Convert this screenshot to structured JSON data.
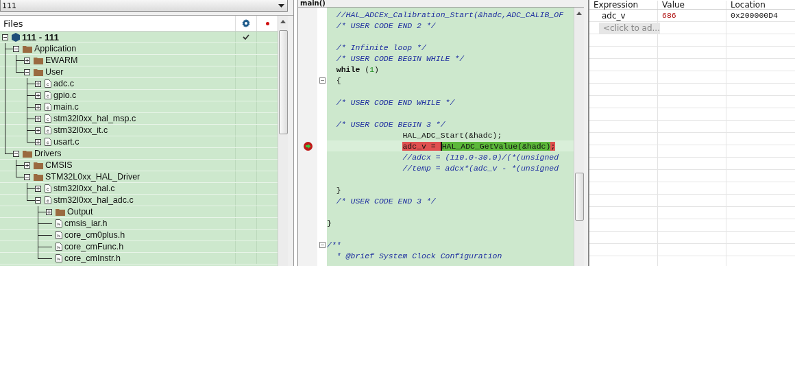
{
  "project_selector": {
    "value": "111"
  },
  "files_panel": {
    "title": "Files",
    "tree": [
      {
        "label": "111 - 111",
        "kind": "project",
        "expanded": true,
        "checked": true,
        "children": [
          {
            "label": "Application",
            "kind": "folder",
            "expanded": true,
            "checked": false,
            "children": [
              {
                "label": "EWARM",
                "kind": "folder",
                "expanded": false,
                "checked": false
              },
              {
                "label": "User",
                "kind": "folder",
                "expanded": true,
                "checked": false,
                "children": [
                  {
                    "label": "adc.c",
                    "kind": "c-file",
                    "expanded": false,
                    "checked": false
                  },
                  {
                    "label": "gpio.c",
                    "kind": "c-file",
                    "expanded": false,
                    "checked": false
                  },
                  {
                    "label": "main.c",
                    "kind": "c-file",
                    "expanded": false,
                    "checked": false
                  },
                  {
                    "label": "stm32l0xx_hal_msp.c",
                    "kind": "c-file",
                    "expanded": false,
                    "checked": false
                  },
                  {
                    "label": "stm32l0xx_it.c",
                    "kind": "c-file",
                    "expanded": false,
                    "checked": false
                  },
                  {
                    "label": "usart.c",
                    "kind": "c-file",
                    "expanded": false,
                    "checked": false
                  }
                ]
              }
            ]
          },
          {
            "label": "Drivers",
            "kind": "folder",
            "expanded": true,
            "checked": false,
            "children": [
              {
                "label": "CMSIS",
                "kind": "folder",
                "expanded": false,
                "checked": false
              },
              {
                "label": "STM32L0xx_HAL_Driver",
                "kind": "folder",
                "expanded": true,
                "checked": false,
                "children": [
                  {
                    "label": "stm32l0xx_hal.c",
                    "kind": "c-file",
                    "expanded": false,
                    "checked": false
                  },
                  {
                    "label": "stm32l0xx_hal_adc.c",
                    "kind": "c-file",
                    "expanded": true,
                    "checked": false,
                    "children": [
                      {
                        "label": "Output",
                        "kind": "folder",
                        "expanded": false,
                        "checked": false
                      },
                      {
                        "label": "cmsis_iar.h",
                        "kind": "h-file",
                        "checked": false
                      },
                      {
                        "label": "core_cm0plus.h",
                        "kind": "h-file",
                        "checked": false
                      },
                      {
                        "label": "core_cmFunc.h",
                        "kind": "h-file",
                        "checked": false
                      },
                      {
                        "label": "core_cmInstr.h",
                        "kind": "h-file",
                        "checked": false
                      }
                    ]
                  }
                ]
              }
            ]
          }
        ]
      }
    ]
  },
  "editor": {
    "tab": "main()",
    "lines": [
      {
        "fold": false,
        "current": false,
        "segments": [
          {
            "kind": "comment",
            "text": "  //HAL_ADCEx_Calibration_Start(&hadc,ADC_CALIB_OF"
          }
        ]
      },
      {
        "fold": false,
        "current": false,
        "segments": [
          {
            "kind": "comment",
            "text": "  /* USER CODE END 2 */"
          }
        ]
      },
      {
        "fold": false,
        "current": false
      },
      {
        "fold": false,
        "current": false,
        "segments": [
          {
            "kind": "comment",
            "text": "  /* Infinite loop */"
          }
        ]
      },
      {
        "fold": false,
        "current": false,
        "segments": [
          {
            "kind": "comment",
            "text": "  /* USER CODE BEGIN WHILE */"
          }
        ]
      },
      {
        "fold": false,
        "current": false,
        "segments": [
          {
            "kind": "keyword",
            "text": "  while"
          },
          {
            "kind": "code",
            "text": " ("
          },
          {
            "kind": "number",
            "text": "1"
          },
          {
            "kind": "code",
            "text": ")"
          }
        ]
      },
      {
        "fold": true,
        "current": false,
        "segments": [
          {
            "kind": "code",
            "text": "  {"
          }
        ]
      },
      {
        "fold": false,
        "current": false
      },
      {
        "fold": false,
        "current": false,
        "segments": [
          {
            "kind": "comment",
            "text": "  /* USER CODE END WHILE */"
          }
        ]
      },
      {
        "fold": false,
        "current": false
      },
      {
        "fold": false,
        "current": false,
        "segments": [
          {
            "kind": "comment",
            "text": "  /* USER CODE BEGIN 3 */"
          }
        ]
      },
      {
        "fold": false,
        "current": false,
        "segments": [
          {
            "kind": "code",
            "text": "                HAL_ADC_Start(&hadc);"
          }
        ]
      },
      {
        "fold": false,
        "current": true,
        "segments": [
          {
            "kind": "error",
            "text": "                adc_v = "
          },
          {
            "kind": "active",
            "text": "HAL_ADC_GetValue(&hadc)"
          },
          {
            "kind": "error",
            "text": ";"
          }
        ]
      },
      {
        "fold": false,
        "current": false,
        "segments": [
          {
            "kind": "comment",
            "text": "                //adcx = (110.0-30.0)/(*(unsigned"
          }
        ]
      },
      {
        "fold": false,
        "current": false,
        "segments": [
          {
            "kind": "comment",
            "text": "                //temp = adcx*(adc_v - *(unsigned"
          }
        ]
      },
      {
        "fold": false,
        "current": false
      },
      {
        "fold": false,
        "current": false,
        "segments": [
          {
            "kind": "code",
            "text": "  }"
          }
        ]
      },
      {
        "fold": false,
        "current": false,
        "segments": [
          {
            "kind": "comment",
            "text": "  /* USER CODE END 3 */"
          }
        ]
      },
      {
        "fold": false,
        "current": false
      },
      {
        "fold": false,
        "current": false,
        "segments": [
          {
            "kind": "code",
            "text": "}"
          }
        ]
      },
      {
        "fold": false,
        "current": false
      },
      {
        "fold": true,
        "current": false,
        "segments": [
          {
            "kind": "comment",
            "text": "/**"
          }
        ]
      },
      {
        "fold": false,
        "current": false,
        "segments": [
          {
            "kind": "comment",
            "text": "  * @brief System Clock Configuration"
          }
        ]
      }
    ]
  },
  "watch": {
    "columns": [
      "Expression",
      "Value",
      "Location"
    ],
    "rows": [
      {
        "expression": "adc_v",
        "value": "686",
        "location": "0x200000D4",
        "changed": true
      }
    ],
    "add_placeholder": "<click to ad..."
  }
}
